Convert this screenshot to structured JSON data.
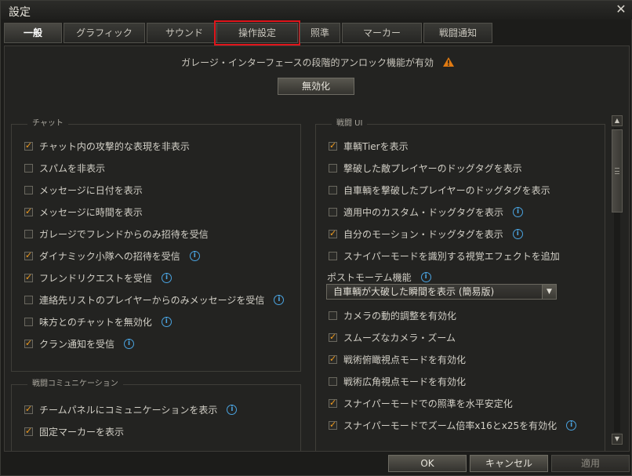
{
  "window": {
    "title": "設定"
  },
  "tabs": [
    {
      "label": "一般",
      "active": true
    },
    {
      "label": "グラフィック"
    },
    {
      "label": "サウンド"
    },
    {
      "label": "操作設定",
      "highlighted": true
    },
    {
      "label": "照準"
    },
    {
      "label": "マーカー"
    },
    {
      "label": "戦闘通知"
    }
  ],
  "banner": {
    "text": "ガレージ・インターフェースの段階的アンロック機能が有効",
    "button": "無効化"
  },
  "chat": {
    "title": "チャット",
    "items": [
      {
        "label": "チャット内の攻撃的な表現を非表示",
        "checked": true
      },
      {
        "label": "スパムを非表示",
        "checked": false
      },
      {
        "label": "メッセージに日付を表示",
        "checked": false
      },
      {
        "label": "メッセージに時間を表示",
        "checked": true
      },
      {
        "label": "ガレージでフレンドからのみ招待を受信",
        "checked": false
      },
      {
        "label": "ダイナミック小隊への招待を受信",
        "checked": true,
        "info": true
      },
      {
        "label": "フレンドリクエストを受信",
        "checked": true,
        "info": true
      },
      {
        "label": "連絡先リストのプレイヤーからのみメッセージを受信",
        "checked": false,
        "info": true
      },
      {
        "label": "味方とのチャットを無効化",
        "checked": false,
        "info": true
      },
      {
        "label": "クラン通知を受信",
        "checked": true,
        "info": true
      }
    ]
  },
  "comms": {
    "title": "戦闘コミュニケーション",
    "items": [
      {
        "label": "チームパネルにコミュニケーションを表示",
        "checked": true,
        "info": true
      },
      {
        "label": "固定マーカーを表示",
        "checked": true
      }
    ]
  },
  "battle_ui": {
    "title": "戦闘 UI",
    "items_top": [
      {
        "label": "車輌Tierを表示",
        "checked": true
      },
      {
        "label": "撃破した敵プレイヤーのドッグタグを表示",
        "checked": false
      },
      {
        "label": "自車輌を撃破したプレイヤーのドッグタグを表示",
        "checked": false
      },
      {
        "label": "適用中のカスタム・ドッグタグを表示",
        "checked": false,
        "info": true
      },
      {
        "label": "自分のモーション・ドッグタグを表示",
        "checked": true,
        "info": true
      },
      {
        "label": "スナイパーモードを識別する視覚エフェクトを追加",
        "checked": false
      }
    ],
    "postmortem_label": "ポストモーテム機能",
    "postmortem_value": "自車輌が大破した瞬間を表示 (簡易版)",
    "items_bottom": [
      {
        "label": "カメラの動的調整を有効化",
        "checked": false
      },
      {
        "label": "スムーズなカメラ・ズーム",
        "checked": true
      },
      {
        "label": "戦術俯瞰視点モードを有効化",
        "checked": true
      },
      {
        "label": "戦術広角視点モードを有効化",
        "checked": false
      },
      {
        "label": "スナイパーモードでの照準を水平安定化",
        "checked": true
      },
      {
        "label": "スナイパーモードでズーム倍率x16とx25を有効化",
        "checked": true,
        "info": true
      }
    ]
  },
  "footer": {
    "ok": "OK",
    "cancel": "キャンセル",
    "apply": "適用"
  },
  "colors": {
    "accent": "#f29c1f",
    "info": "#4aa3e0",
    "highlight": "#e0151b"
  }
}
